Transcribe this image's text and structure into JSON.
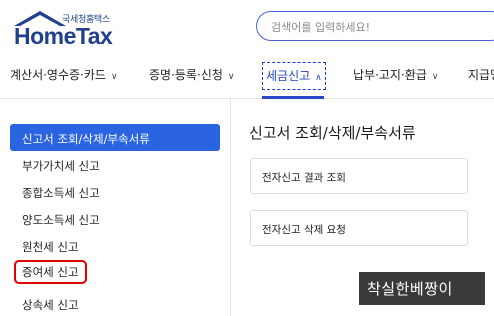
{
  "header": {
    "logo_sub": "국세청홈택스",
    "logo_text": "HomeTax",
    "search_placeholder": "검색어를 입력하세요!"
  },
  "nav": {
    "items": [
      {
        "label": "계산서·영수증·카드",
        "chev": "∨"
      },
      {
        "label": "증명·등록·신청",
        "chev": "∨"
      },
      {
        "label": "세금신고",
        "chev": "∧",
        "active": true
      },
      {
        "label": "납부·고지·환급",
        "chev": "∨"
      },
      {
        "label": "지급명"
      }
    ]
  },
  "sidebar": {
    "items": [
      {
        "label": "신고서 조회/삭제/부속서류",
        "active": true
      },
      {
        "label": "부가가치세 신고"
      },
      {
        "label": "종합소득세 신고"
      },
      {
        "label": "양도소득세 신고"
      },
      {
        "label": "원천세 신고"
      },
      {
        "label": "증여세 신고",
        "highlighted": true
      },
      {
        "label": "상속세 신고"
      }
    ]
  },
  "main": {
    "title": "신고서 조회/삭제/부속서류",
    "cards": [
      {
        "label": "전자신고 결과 조회"
      },
      {
        "label": "전자신고 삭제 요청"
      }
    ]
  },
  "watermark": {
    "text": "착실한베짱이"
  },
  "colors": {
    "brand": "#1f3f8f",
    "accent": "#2a46c8",
    "sidebar_active": "#2a64e0",
    "highlight_border": "#e00000"
  }
}
